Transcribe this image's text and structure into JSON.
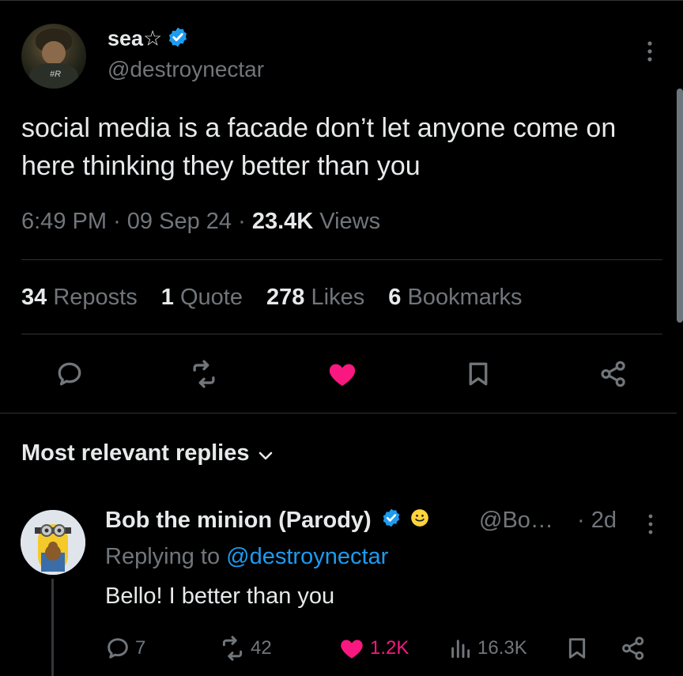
{
  "tweet": {
    "author_name": "sea☆",
    "author_handle": "@destroynectar",
    "text": "social media is a facade don’t let anyone come on here thinking they better than you",
    "time": "6:49 PM",
    "date": "09 Sep 24",
    "views_count": "23.4K",
    "views_label": "Views",
    "separator": "·"
  },
  "stats": {
    "reposts_count": "34",
    "reposts_label": "Reposts",
    "quotes_count": "1",
    "quotes_label": "Quote",
    "likes_count": "278",
    "likes_label": "Likes",
    "bookmarks_count": "6",
    "bookmarks_label": "Bookmarks"
  },
  "replies_header": "Most relevant replies",
  "reply": {
    "author_name": "Bob the minion (Parody)",
    "author_handle": "@Bo…",
    "time": "· 2d",
    "replying_prefix": "Replying to",
    "replying_handle": "@destroynectar",
    "text": "Bello! I better than you",
    "replies": "7",
    "reposts": "42",
    "likes": "1.2K",
    "views": "16.3K"
  },
  "colors": {
    "background": "#000000",
    "text": "#e7e9ea",
    "muted": "#71767b",
    "link": "#1d9bf0",
    "like": "#f91880",
    "verified": "#1d9bf0",
    "emoji_badge": "#ffd43b"
  }
}
